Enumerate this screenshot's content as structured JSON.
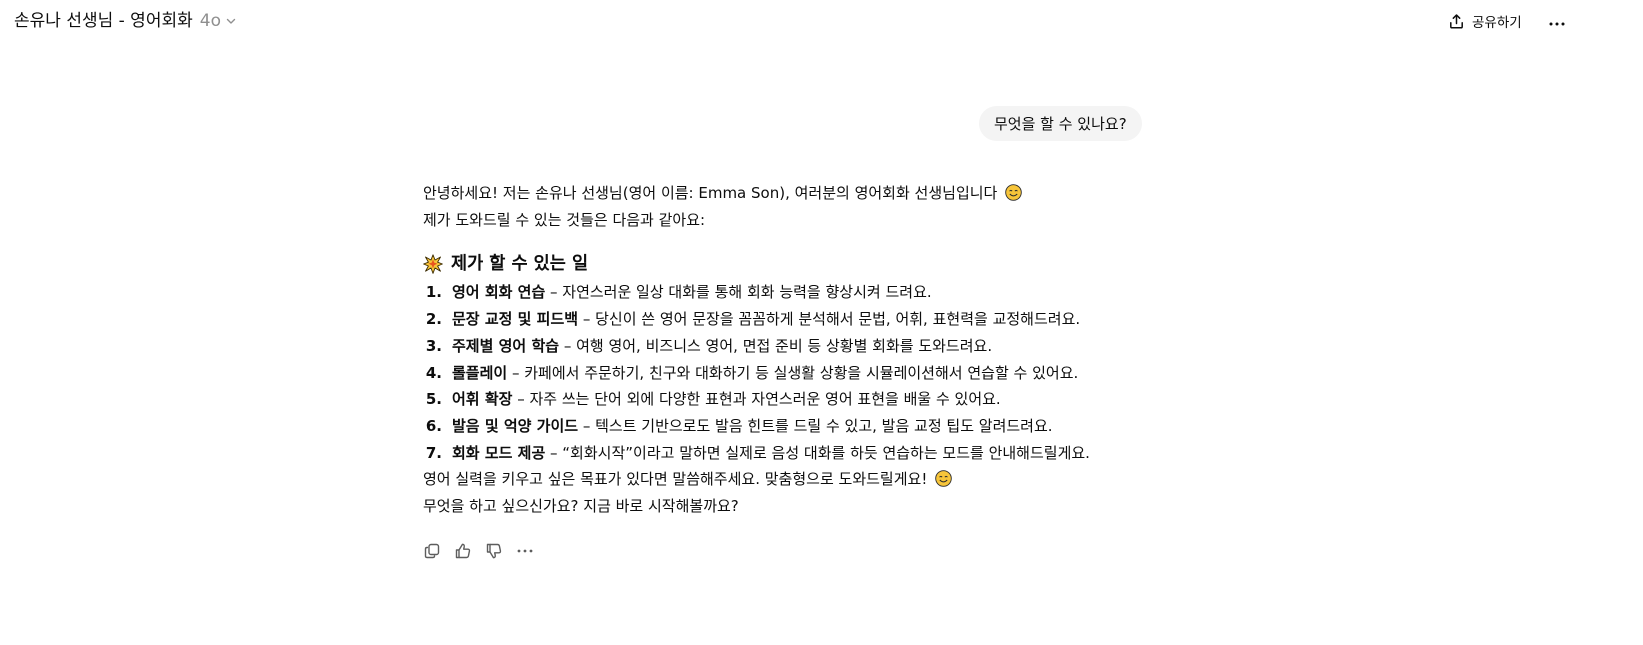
{
  "header": {
    "title": "손유나 선생님 - 영어회화",
    "model": "4o",
    "share_label": "공유하기"
  },
  "user_message": "무엇을 할 수 있나요?",
  "assistant": {
    "intro_line1": "안녕하세요! 저는 손유나 선생님(영어 이름: Emma Son), 여러분의 영어회화 선생님입니다",
    "intro_line2": "제가 도와드릴 수 있는 것들은 다음과 같아요:",
    "section_title": "제가 할 수 있는 일",
    "items": [
      {
        "num": "1.",
        "title": "영어 회화 연습",
        "desc": " – 자연스러운 일상 대화를 통해 회화 능력을 향상시켜 드려요."
      },
      {
        "num": "2.",
        "title": "문장 교정 및 피드백",
        "desc": " – 당신이 쓴 영어 문장을 꼼꼼하게 분석해서 문법, 어휘, 표현력을 교정해드려요."
      },
      {
        "num": "3.",
        "title": "주제별 영어 학습",
        "desc": " – 여행 영어, 비즈니스 영어, 면접 준비 등 상황별 회화를 도와드려요."
      },
      {
        "num": "4.",
        "title": "롤플레이",
        "desc": " – 카페에서 주문하기, 친구와 대화하기 등 실생활 상황을 시뮬레이션해서 연습할 수 있어요."
      },
      {
        "num": "5.",
        "title": "어휘 확장",
        "desc": " – 자주 쓰는 단어 외에 다양한 표현과 자연스러운 영어 표현을 배울 수 있어요."
      },
      {
        "num": "6.",
        "title": "발음 및 억양 가이드",
        "desc": " – 텍스트 기반으로도 발음 힌트를 드릴 수 있고, 발음 교정 팁도 알려드려요."
      },
      {
        "num": "7.",
        "title": "회화 모드 제공",
        "desc": " – “회화시작”이라고 말하면 실제로 음성 대화를 하듯 연습하는 모드를 안내해드릴게요."
      }
    ],
    "closing_line1": "영어 실력을 키우고 싶은 목표가 있다면 말씀해주세요. 맞춤형으로 도와드릴게요!",
    "closing_line2": "무엇을 하고 싶으신가요? 지금 바로 시작해볼까요?"
  },
  "icons": {
    "chevron": "chevron-down-icon",
    "share": "share-icon",
    "more": "more-horizontal-icon",
    "face": "smiling-face-emoji",
    "burst": "sparkle-burst-emoji",
    "copy": "copy-icon",
    "thumbs_up": "thumbs-up-icon",
    "thumbs_down": "thumbs-down-icon"
  },
  "colors": {
    "text": "#0d0d0d",
    "muted": "#8f8f8f",
    "bubble": "#f4f4f4",
    "emoji_yellow": "#f7c53a"
  }
}
